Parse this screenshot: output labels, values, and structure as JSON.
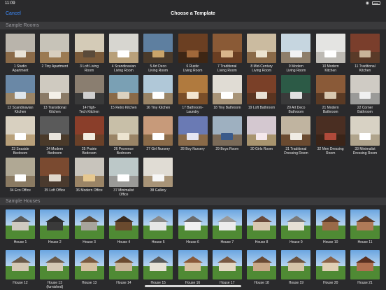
{
  "status": {
    "time": "11:09",
    "wifi": "wifi-icon",
    "battery": "battery-icon"
  },
  "nav": {
    "cancel": "Cancel",
    "title": "Choose a Template"
  },
  "sections": {
    "rooms_header": "Sample Rooms",
    "houses_header": "Sample Houses"
  },
  "rooms": [
    {
      "l1": "1 Studio",
      "l2": "Apartment",
      "wall": "#b9b4ab",
      "floor": "#8a6a48",
      "furn": "#e8e2d6"
    },
    {
      "l1": "2 Tiny Apartment",
      "l2": "",
      "wall": "#c7c3b8",
      "floor": "#9b7a52",
      "furn": "#d8cfbf"
    },
    {
      "l1": "3 Loft Living",
      "l2": "Room",
      "wall": "#d4cbb7",
      "floor": "#7a5a3a",
      "furn": "#5a4a3a"
    },
    {
      "l1": "4 Scandinavian",
      "l2": "Living Room",
      "wall": "#d7d6d0",
      "floor": "#b8a07a",
      "furn": "#ffffff"
    },
    {
      "l1": "5 Art Deco",
      "l2": "Living Room",
      "wall": "#5e7fa0",
      "floor": "#4a3a2a",
      "furn": "#c9a46a"
    },
    {
      "l1": "6 Rustic",
      "l2": "Living Room",
      "wall": "#6b3f22",
      "floor": "#3e2614",
      "furn": "#a0683a"
    },
    {
      "l1": "7 Traditional",
      "l2": "Living Room",
      "wall": "#8a5a36",
      "floor": "#6a3e22",
      "furn": "#d8b48a"
    },
    {
      "l1": "8 Mid-Century",
      "l2": "Living Room",
      "wall": "#cbbba0",
      "floor": "#8a6a48",
      "furn": "#ece3d0"
    },
    {
      "l1": "9 Modern",
      "l2": "Living Room",
      "wall": "#c6d6e0",
      "floor": "#8e7e6a",
      "furn": "#f2f2f2"
    },
    {
      "l1": "10 Modern",
      "l2": "Kitchen",
      "wall": "#e4e4e2",
      "floor": "#bdbab4",
      "furn": "#ffffff"
    },
    {
      "l1": "11 Traditional",
      "l2": "Kitchen",
      "wall": "#7a3e2c",
      "floor": "#5a3a28",
      "furn": "#c8b49a"
    },
    {
      "l1": "12 Scandinavian",
      "l2": "Kitchen",
      "wall": "#6a88a6",
      "floor": "#9a8466",
      "furn": "#dfe6ec"
    },
    {
      "l1": "13 Transitional",
      "l2": "Kitchen",
      "wall": "#cfcac0",
      "floor": "#8a7a66",
      "furn": "#f4f0e8"
    },
    {
      "l1": "14 High-",
      "l2": "Tech Kitchen",
      "wall": "#8a7e70",
      "floor": "#3a3a3a",
      "furn": "#d0d0d0"
    },
    {
      "l1": "15 Retro Kitchen",
      "l2": "",
      "wall": "#7aa0b4",
      "floor": "#8a6a48",
      "furn": "#dcd2c0"
    },
    {
      "l1": "16 Tiny Kitchen",
      "l2": "",
      "wall": "#b0c8d8",
      "floor": "#9a8466",
      "furn": "#ffffff"
    },
    {
      "l1": "17 Bathroom-",
      "l2": "Laundry",
      "wall": "#b07a3e",
      "floor": "#7a4e28",
      "furn": "#f2e6d2"
    },
    {
      "l1": "18 Tiny Bathroom",
      "l2": "",
      "wall": "#e0dcd4",
      "floor": "#a89478",
      "furn": "#ffffff"
    },
    {
      "l1": "19 Loft Bathroom",
      "l2": "",
      "wall": "#7a4028",
      "floor": "#5a3420",
      "furn": "#e8e0d4"
    },
    {
      "l1": "20 Art Deco",
      "l2": "Bathroom",
      "wall": "#2c5a46",
      "floor": "#3a3a3a",
      "furn": "#e0e0e0"
    },
    {
      "l1": "21 Modern",
      "l2": "Bathroom",
      "wall": "#8a5a38",
      "floor": "#5a3a24",
      "furn": "#d8c8b0"
    },
    {
      "l1": "22 Corner",
      "l2": "Bathroom",
      "wall": "#cfcbc4",
      "floor": "#9a9a98",
      "furn": "#f0f0f0"
    },
    {
      "l1": "23 Seaside",
      "l2": "Bedroom",
      "wall": "#d8d0c0",
      "floor": "#b8a07a",
      "furn": "#ffffff"
    },
    {
      "l1": "24 Modern",
      "l2": "Bedroom",
      "wall": "#5a5a5a",
      "floor": "#4a3a2a",
      "furn": "#e8e4dc"
    },
    {
      "l1": "25 Prairie",
      "l2": "Bedroom",
      "wall": "#8a3e2a",
      "floor": "#6a4028",
      "furn": "#f2ece0"
    },
    {
      "l1": "26 Provence",
      "l2": "Bedroom",
      "wall": "#c8bfa8",
      "floor": "#9a8466",
      "furn": "#ece4d0"
    },
    {
      "l1": "27 Girl Nursery",
      "l2": "",
      "wall": "#c79a7a",
      "floor": "#8a6a48",
      "furn": "#ffffff"
    },
    {
      "l1": "28 Boy Nursery",
      "l2": "",
      "wall": "#6a7ab4",
      "floor": "#8a6a48",
      "furn": "#e6e6f2"
    },
    {
      "l1": "29 Boys Room",
      "l2": "",
      "wall": "#9eb0c0",
      "floor": "#7a6a58",
      "furn": "#3a5a8a"
    },
    {
      "l1": "30 Girls Room",
      "l2": "",
      "wall": "#d4c8d0",
      "floor": "#a8946e",
      "furn": "#f4e8ec"
    },
    {
      "l1": "31 Traditional",
      "l2": "Dressing Room",
      "wall": "#c0b4a0",
      "floor": "#6a4a30",
      "furn": "#f0ece4"
    },
    {
      "l1": "32 Men Dressing",
      "l2": "Room",
      "wall": "#4a2e22",
      "floor": "#3a2418",
      "furn": "#b04a3a"
    },
    {
      "l1": "33 Minimalist",
      "l2": "Dressing Room",
      "wall": "#d8d2c4",
      "floor": "#b0a48c",
      "furn": "#ffffff"
    },
    {
      "l1": "34 Eco Office",
      "l2": "",
      "wall": "#b0a894",
      "floor": "#8a7a62",
      "furn": "#ffffff"
    },
    {
      "l1": "35 Loft Office",
      "l2": "",
      "wall": "#7a4a30",
      "floor": "#4a3a2e",
      "furn": "#e0d8cc"
    },
    {
      "l1": "36 Modern Office",
      "l2": "",
      "wall": "#c8c4bc",
      "floor": "#9a8466",
      "furn": "#e6c890"
    },
    {
      "l1": "37 Minimalist",
      "l2": "Office",
      "wall": "#bcc8c8",
      "floor": "#9a9a98",
      "furn": "#ffffff"
    },
    {
      "l1": "38 Gallery",
      "l2": "",
      "wall": "#e0dcd4",
      "floor": "#a89478",
      "furn": "#f6f6f6"
    }
  ],
  "houses": [
    {
      "l1": "House 1",
      "l2": "",
      "body": "#cfcac0",
      "roof": "#5a5a5a"
    },
    {
      "l1": "House 2",
      "l2": "",
      "body": "#3a3a3a",
      "roof": "#2a2a2a"
    },
    {
      "l1": "House 3",
      "l2": "",
      "body": "#a8a49c",
      "roof": "#5a4a3a"
    },
    {
      "l1": "House 4",
      "l2": "",
      "body": "#6a4a2e",
      "roof": "#3a2a1e"
    },
    {
      "l1": "House 5",
      "l2": "",
      "body": "#e6e6e6",
      "roof": "#8a8a8a"
    },
    {
      "l1": "House 6",
      "l2": "",
      "body": "#f0f0f0",
      "roof": "#6a6a6a"
    },
    {
      "l1": "House 7",
      "l2": "",
      "body": "#ececec",
      "roof": "#9a9a9a"
    },
    {
      "l1": "House 8",
      "l2": "",
      "body": "#d8c8b0",
      "roof": "#6a4a3a"
    },
    {
      "l1": "House 9",
      "l2": "",
      "body": "#e6e0d4",
      "roof": "#7a7a7a"
    },
    {
      "l1": "House 10",
      "l2": "",
      "body": "#9a6a48",
      "roof": "#5a3a28"
    },
    {
      "l1": "House 11",
      "l2": "",
      "body": "#b07a58",
      "roof": "#5a3a2a"
    },
    {
      "l1": "House 12",
      "l2": "",
      "body": "#d4c8b4",
      "roof": "#6a5a4a"
    },
    {
      "l1": "House 13",
      "l2": "(furnished)",
      "body": "#d4c8b4",
      "roof": "#6a5a4a"
    },
    {
      "l1": "House 13",
      "l2": "",
      "body": "#d4c0a0",
      "roof": "#7a5a40"
    },
    {
      "l1": "House 14",
      "l2": "",
      "body": "#c8b498",
      "roof": "#6a4a30"
    },
    {
      "l1": "House 15",
      "l2": "",
      "body": "#e8e2d6",
      "roof": "#5a5a5a"
    },
    {
      "l1": "House 16",
      "l2": "",
      "body": "#d8c0a0",
      "roof": "#8a5a3a"
    },
    {
      "l1": "House 17",
      "l2": "",
      "body": "#e4d8c4",
      "roof": "#7a5a44"
    },
    {
      "l1": "House 18",
      "l2": "",
      "body": "#c8a888",
      "roof": "#6a4a34"
    },
    {
      "l1": "House 19",
      "l2": "",
      "body": "#d4c4a8",
      "roof": "#6a5240"
    },
    {
      "l1": "House 20",
      "l2": "",
      "body": "#e0d0b4",
      "roof": "#8a6248"
    },
    {
      "l1": "House 21",
      "l2": "",
      "body": "#b07050",
      "roof": "#5a3020"
    }
  ]
}
